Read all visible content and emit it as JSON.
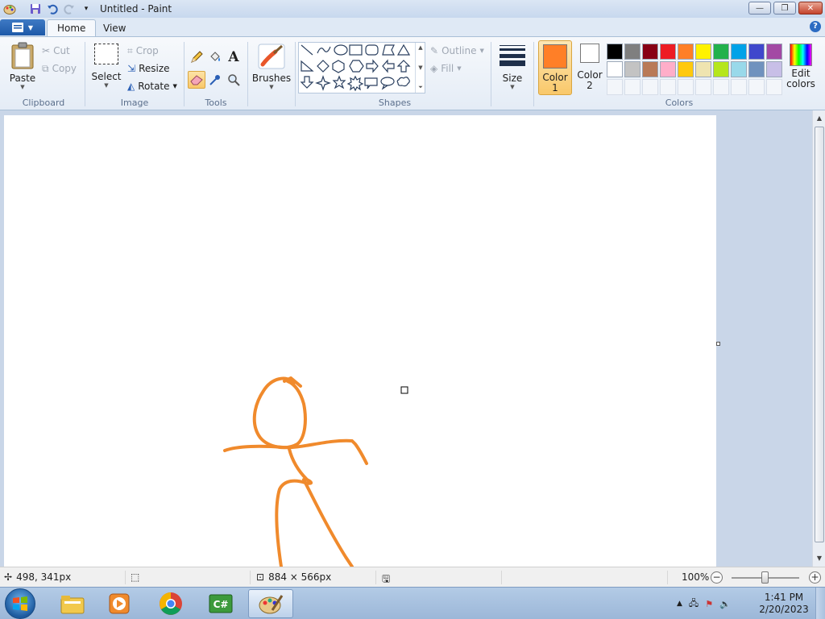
{
  "window": {
    "title": "Untitled - Paint",
    "buttons": {
      "minimize": "—",
      "restore": "❐",
      "close": "✕"
    }
  },
  "tabs": [
    {
      "label": "Home",
      "active": true
    },
    {
      "label": "View",
      "active": false
    }
  ],
  "ribbon": {
    "clipboard": {
      "label": "Clipboard",
      "paste": "Paste",
      "cut": "Cut",
      "copy": "Copy"
    },
    "image": {
      "label": "Image",
      "select": "Select",
      "crop": "Crop",
      "resize": "Resize",
      "rotate": "Rotate"
    },
    "tools": {
      "label": "Tools",
      "items": [
        "pencil",
        "fill",
        "text",
        "eraser",
        "color-picker",
        "magnifier"
      ],
      "active": "eraser"
    },
    "brushes": {
      "label": "Brushes"
    },
    "shapes": {
      "label": "Shapes",
      "outline": "Outline",
      "fill": "Fill"
    },
    "size": {
      "label": "Size"
    },
    "colors": {
      "label": "Colors",
      "color1_label": "Color",
      "color1_num": "1",
      "color2_label": "Color",
      "color2_num": "2",
      "color1": "#ff7f27",
      "color2": "#ffffff",
      "edit_label": "Edit",
      "edit_label2": "colors",
      "palette_row1": [
        "#000000",
        "#7f7f7f",
        "#880015",
        "#ed1c24",
        "#ff7f27",
        "#fff200",
        "#22b14c",
        "#00a2e8",
        "#3f48cc",
        "#a349a4"
      ],
      "palette_row2": [
        "#ffffff",
        "#c3c3c3",
        "#b97a57",
        "#ffaec9",
        "#ffc90e",
        "#efe4b0",
        "#b5e61d",
        "#99d9ea",
        "#7092be",
        "#c8bfe7"
      ]
    }
  },
  "canvas": {
    "stroke_color": "#f08a2c"
  },
  "status": {
    "cursor_pos": "498, 341px",
    "canvas_size": "884 × 566px",
    "zoom": "100%"
  },
  "taskbar": {
    "apps": [
      "file-explorer",
      "media-player",
      "chrome",
      "csharp-ide",
      "paint"
    ],
    "active_app": "paint",
    "time": "1:41 PM",
    "date": "2/20/2023"
  }
}
